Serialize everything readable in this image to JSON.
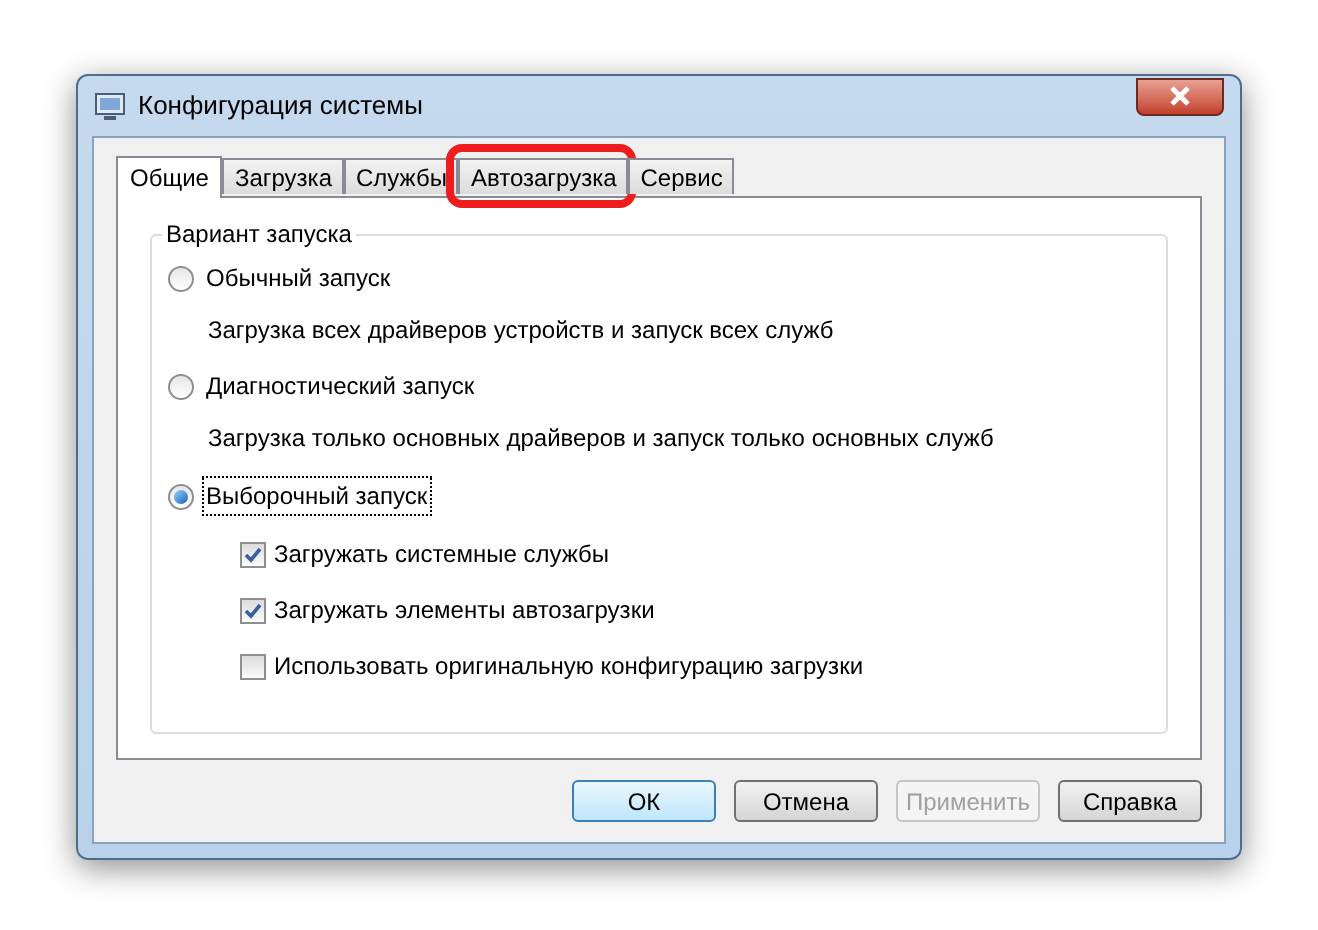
{
  "window": {
    "title": "Конфигурация системы"
  },
  "tabs": [
    {
      "label": "Общие",
      "selected": true,
      "highlighted": false
    },
    {
      "label": "Загрузка",
      "selected": false,
      "highlighted": false
    },
    {
      "label": "Службы",
      "selected": false,
      "highlighted": false
    },
    {
      "label": "Автозагрузка",
      "selected": false,
      "highlighted": true
    },
    {
      "label": "Сервис",
      "selected": false,
      "highlighted": false
    }
  ],
  "group": {
    "title": "Вариант запуска",
    "options": [
      {
        "label": "Обычный запуск",
        "selected": false,
        "description": "Загрузка всех драйверов устройств и запуск всех служб"
      },
      {
        "label": "Диагностический запуск",
        "selected": false,
        "description": "Загрузка только основных драйверов и запуск только основных служб"
      },
      {
        "label": "Выборочный запуск",
        "selected": true,
        "focused": true,
        "checkboxes": [
          {
            "label": "Загружать системные службы",
            "checked": true
          },
          {
            "label": "Загружать элементы автозагрузки",
            "checked": true
          },
          {
            "label": "Использовать оригинальную конфигурацию загрузки",
            "checked": false
          }
        ]
      }
    ]
  },
  "buttons": [
    {
      "label": "ОК",
      "kind": "default",
      "disabled": false
    },
    {
      "label": "Отмена",
      "kind": "normal",
      "disabled": false
    },
    {
      "label": "Применить",
      "kind": "normal",
      "disabled": true
    },
    {
      "label": "Справка",
      "kind": "normal",
      "disabled": false
    }
  ]
}
